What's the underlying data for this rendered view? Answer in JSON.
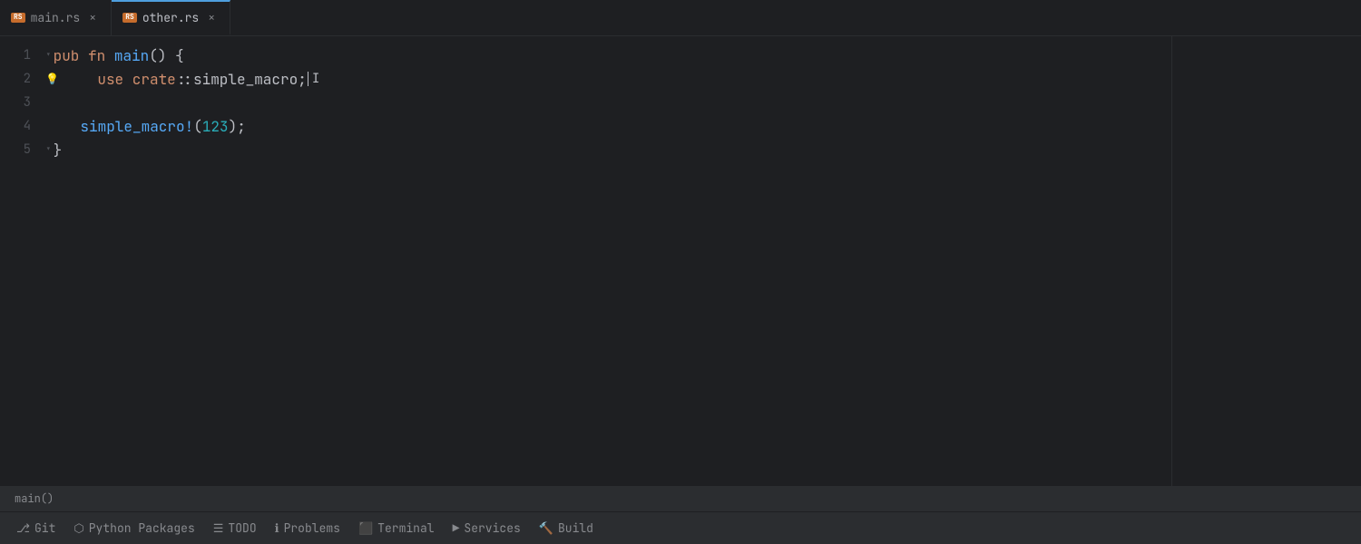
{
  "tabs": [
    {
      "id": "main-rs",
      "label": "main.rs",
      "icon": "RS",
      "active": false
    },
    {
      "id": "other-rs",
      "label": "other.rs",
      "icon": "RS",
      "active": true
    }
  ],
  "editor": {
    "lines": [
      {
        "number": 1,
        "hasFold": true,
        "hasHint": false,
        "content": "pub fn main() {"
      },
      {
        "number": 2,
        "hasFold": false,
        "hasHint": true,
        "content": "    use crate::simple_macro;"
      },
      {
        "number": 3,
        "hasFold": false,
        "hasHint": false,
        "content": ""
      },
      {
        "number": 4,
        "hasFold": false,
        "hasHint": false,
        "content": "    simple_macro!(123);"
      },
      {
        "number": 5,
        "hasFold": true,
        "hasHint": false,
        "content": "}"
      }
    ]
  },
  "breadcrumb": {
    "text": "main()"
  },
  "toolbar": {
    "items": [
      {
        "id": "git",
        "icon": "git-icon",
        "label": "Git"
      },
      {
        "id": "python-packages",
        "icon": "python-icon",
        "label": "Python Packages"
      },
      {
        "id": "todo",
        "icon": "todo-icon",
        "label": "TODO"
      },
      {
        "id": "problems",
        "icon": "problems-icon",
        "label": "Problems"
      },
      {
        "id": "terminal",
        "icon": "terminal-icon",
        "label": "Terminal"
      },
      {
        "id": "services",
        "icon": "services-icon",
        "label": "Services"
      },
      {
        "id": "build",
        "icon": "build-icon",
        "label": "Build"
      }
    ]
  }
}
